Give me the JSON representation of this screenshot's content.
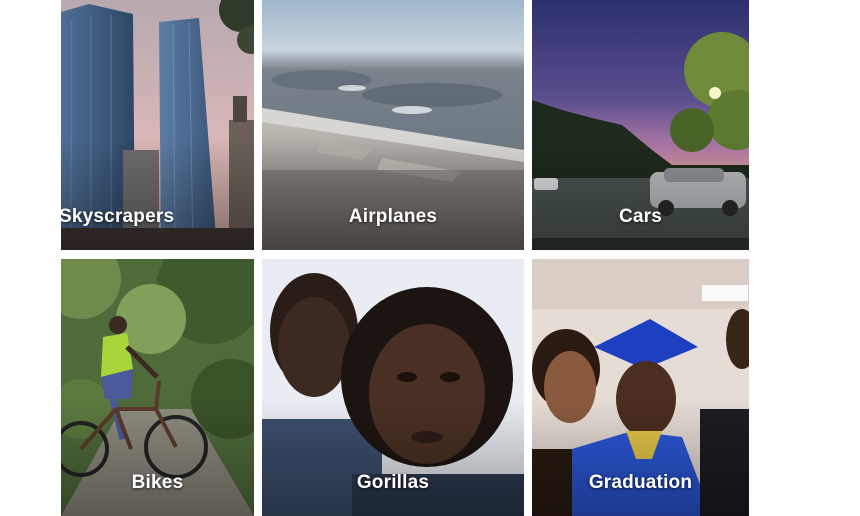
{
  "albums": [
    {
      "label": "Skyscrapers"
    },
    {
      "label": "Airplanes"
    },
    {
      "label": "Cars"
    },
    {
      "label": "Bikes"
    },
    {
      "label": "Gorillas"
    },
    {
      "label": "Graduation"
    }
  ]
}
